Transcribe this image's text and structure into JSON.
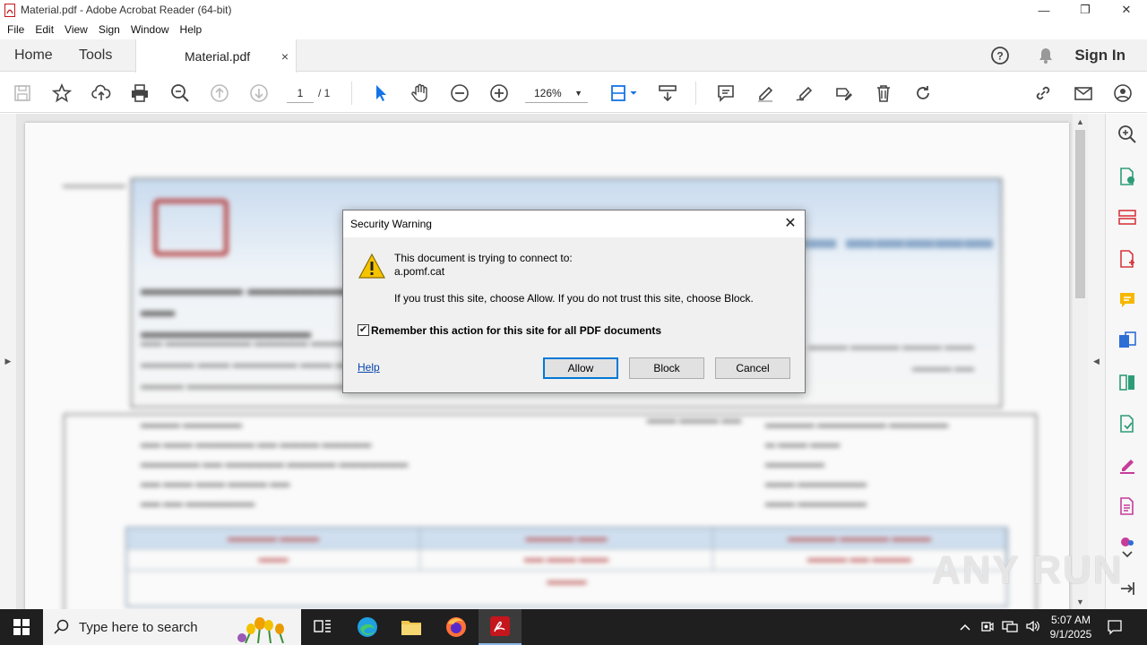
{
  "window": {
    "title": "Material.pdf - Adobe Acrobat Reader (64-bit)",
    "minimize": "—",
    "restore": "❐",
    "close": "✕"
  },
  "menu": [
    "File",
    "Edit",
    "View",
    "Sign",
    "Window",
    "Help"
  ],
  "tabs": {
    "home": "Home",
    "tools": "Tools",
    "document": "Material.pdf",
    "close": "×",
    "signin": "Sign In"
  },
  "toolbar": {
    "page_current": "1",
    "page_total": "/ 1",
    "zoom": "126%"
  },
  "dialog": {
    "title": "Security Warning",
    "message": "This document is trying to connect to:",
    "host": "a.pomf.cat",
    "advice": "If you trust this site, choose Allow. If you do not trust this site, choose Block.",
    "remember_label": "Remember this action for this site for all PDF documents",
    "remember_checked": true,
    "help_link": "Help",
    "allow_label": "Allow",
    "block_label": "Block",
    "cancel_label": "Cancel"
  },
  "watermark": "ANY RUN",
  "taskbar": {
    "search_placeholder": "Type here to search",
    "time": "5:07 AM",
    "date": "9/1/2025"
  },
  "colors": {
    "accent": "#0078d7",
    "acrobat_red": "#c4161c",
    "selection_blue": "#1473e6",
    "taskbar": "#1f1f1f"
  }
}
